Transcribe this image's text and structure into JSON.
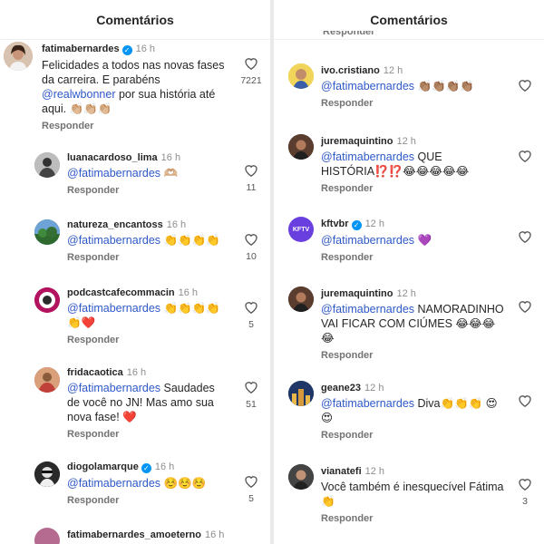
{
  "left": {
    "header_title": "Comentários",
    "comments": [
      {
        "username": "fatimabernardes",
        "verified": true,
        "time": "16 h",
        "mention": "",
        "text": "Felicidades a todos nas novas fases da carreira. E parabéns ",
        "mention2": "@realwbonner",
        "text2": " por sua história até aqui. 👏🏼👏🏼👏🏼",
        "reply": "Responder",
        "likes": "7221",
        "avatar_color": "#c9a38b",
        "avatar_icon": "woman-avatar-icon"
      },
      {
        "username": "luanacardoso_lima",
        "verified": false,
        "time": "16 h",
        "mention": "@fatimabernardes",
        "text": " 🫶🏼",
        "reply": "Responder",
        "likes": "11",
        "avatar_color": "#9a9a9a",
        "avatar_icon": "bw-photo-avatar-icon"
      },
      {
        "username": "natureza_encantoss",
        "verified": false,
        "time": "16 h",
        "mention": "@fatimabernardes",
        "text": " 👏👏👏👏",
        "reply": "Responder",
        "likes": "10",
        "avatar_color": "#3b7a3a",
        "avatar_icon": "landscape-avatar-icon"
      },
      {
        "username": "podcastcafecommacin",
        "verified": false,
        "time": "16 h",
        "mention": "@fatimabernardes",
        "text": " 👏👏👏👏 👏❤️",
        "reply": "Responder",
        "likes": "5",
        "avatar_color": "#b2125e",
        "avatar_icon": "podcast-logo-avatar-icon"
      },
      {
        "username": "fridacaotica",
        "verified": false,
        "time": "16 h",
        "mention": "@fatimabernardes",
        "text": " Saudades de você no JN! Mas amo sua nova fase! ❤️",
        "reply": "Responder",
        "likes": "51",
        "avatar_color": "#c0413a",
        "avatar_icon": "person-avatar-icon"
      },
      {
        "username": "diogolamarque",
        "verified": true,
        "time": "16 h",
        "mention": "@fatimabernardes",
        "text": " ☺️☺️☺️",
        "reply": "Responder",
        "likes": "5",
        "avatar_color": "#222222",
        "avatar_icon": "man-avatar-icon"
      },
      {
        "username": "fatimabernardes_amoeterno",
        "verified": false,
        "time": "16 h",
        "mention": "",
        "text": "",
        "reply": "",
        "likes": "",
        "avatar_color": "#b56a8f",
        "avatar_icon": "fan-avatar-icon"
      }
    ]
  },
  "right": {
    "header_title": "Comentários",
    "partial_reply": "Responder",
    "comments": [
      {
        "username": "ivo.cristiano",
        "verified": false,
        "time": "12 h",
        "mention": "@fatimabernardes",
        "text": " 👏🏽👏🏽👏🏽👏🏽",
        "reply": "Responder",
        "likes": "",
        "avatar_color": "#e0c14a",
        "avatar_icon": "person-avatar-icon"
      },
      {
        "username": "juremaquintino",
        "verified": false,
        "time": "12 h",
        "mention": "@fatimabernardes",
        "text": " QUE HISTÓRIA⁉️⁉️😂😂😂😂😂",
        "reply": "Responder",
        "likes": "",
        "avatar_color": "#4a3328",
        "avatar_icon": "woman-avatar-icon"
      },
      {
        "username": "kftvbr",
        "verified": true,
        "time": "12 h",
        "mention": "@fatimabernardes",
        "text": " 💜",
        "reply": "Responder",
        "likes": "",
        "avatar_color": "#6a3fe0",
        "avatar_icon": "kftv-logo-avatar-icon",
        "avatar_text": "KFTV"
      },
      {
        "username": "juremaquintino",
        "verified": false,
        "time": "12 h",
        "mention": "@fatimabernardes",
        "text": " NAMORADINHO VAI FICAR COM CIÚMES 😂😂😂😂",
        "reply": "Responder",
        "likes": "",
        "avatar_color": "#4a3328",
        "avatar_icon": "woman-avatar-icon"
      },
      {
        "username": "geane23",
        "verified": false,
        "time": "12 h",
        "mention": "@fatimabernardes",
        "text": " Diva👏👏👏 😍😍",
        "reply": "Responder",
        "likes": "",
        "avatar_color": "#2e4f86",
        "avatar_icon": "city-avatar-icon"
      },
      {
        "username": "vianatefi",
        "verified": false,
        "time": "12 h",
        "mention": "",
        "text": "Você também é inesquecível Fátima 👏",
        "reply": "Responder",
        "likes": "3",
        "avatar_color": "#3a3a3a",
        "avatar_icon": "woman-avatar-icon"
      }
    ]
  }
}
